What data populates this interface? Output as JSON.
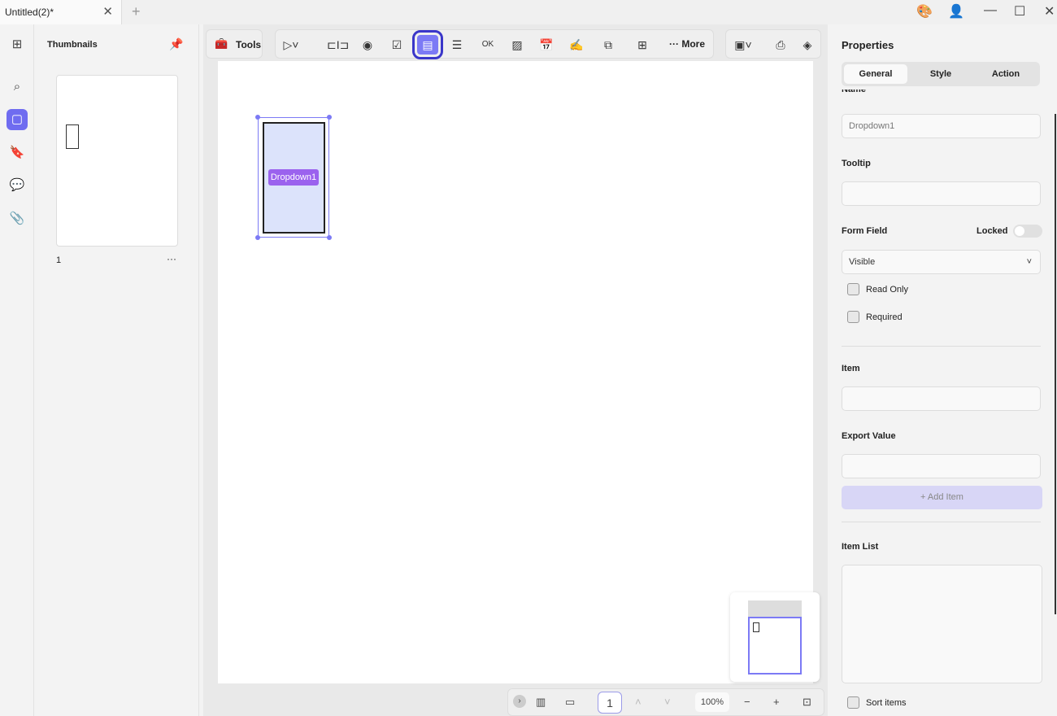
{
  "tab": {
    "title": "Untitled(2)*"
  },
  "sidebar": {
    "title": "Thumbnails",
    "page_number": "1",
    "more": "···"
  },
  "toolbar": {
    "tools_label": "Tools",
    "more_label": "More"
  },
  "canvas": {
    "field_label": "Dropdown1"
  },
  "bottom": {
    "page": "1",
    "zoom": "100%"
  },
  "properties": {
    "title": "Properties",
    "tabs": [
      "General",
      "Style",
      "Action"
    ],
    "name_label": "Name",
    "name_value": "Dropdown1",
    "tooltip_label": "Tooltip",
    "form_field_label": "Form Field",
    "locked_label": "Locked",
    "visibility": "Visible",
    "read_only": "Read Only",
    "required": "Required",
    "item_label": "Item",
    "export_label": "Export Value",
    "add_item": "+ Add Item",
    "item_list_label": "Item List",
    "sort_items": "Sort items"
  },
  "colors": {
    "accent": "#6f6cf0",
    "field_bg": "#dce3fb",
    "tag": "#9b62ee"
  }
}
